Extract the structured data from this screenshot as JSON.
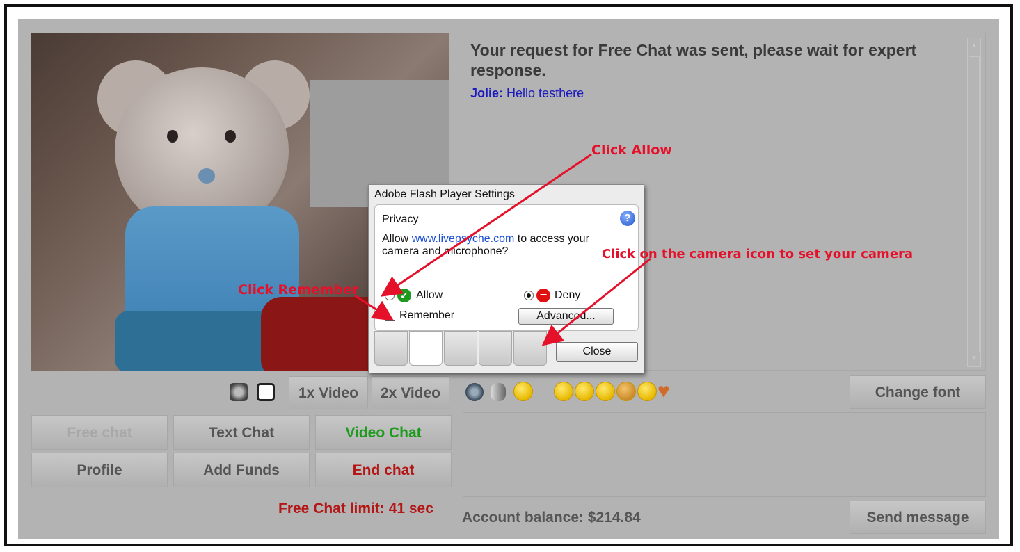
{
  "chat": {
    "system_message": "Your request for Free Chat was sent, please wait for expert response.",
    "sender": "Jolie:",
    "message": "Hello testhere"
  },
  "video_controls": {
    "btn_1x": "1x Video",
    "btn_2x": "2x Video"
  },
  "toolbar": {
    "change_font": "Change font",
    "send_message": "Send message"
  },
  "chat_buttons": {
    "free_chat": "Free chat",
    "text_chat": "Text Chat",
    "video_chat": "Video Chat",
    "profile": "Profile",
    "add_funds": "Add Funds",
    "end_chat": "End chat"
  },
  "status": {
    "free_chat_limit": "Free Chat limit: 41 sec",
    "account_balance": "Account balance: $214.84"
  },
  "flash_dialog": {
    "title": "Adobe Flash Player Settings",
    "section": "Privacy",
    "help": "?",
    "prompt_prefix": "Allow ",
    "prompt_domain": "www.livepsyche.com",
    "prompt_suffix": " to access your",
    "prompt_line2": "camera and microphone?",
    "allow_label": "Allow",
    "deny_label": "Deny",
    "remember_label": "Remember",
    "advanced_button": "Advanced...",
    "close_button": "Close",
    "selected_option": "Deny"
  },
  "annotations": {
    "click_allow": "Click Allow",
    "click_remember": "Click Remember",
    "click_camera": "Click on the camera icon to set your camera"
  },
  "colors": {
    "annotation_red": "#e5102a",
    "end_chat_red": "#b41616",
    "video_chat_green": "#1e9a1e",
    "chat_blue": "#1a1abe"
  },
  "icons": [
    "settings-icon",
    "fullscreen-icon",
    "webcam-icon",
    "microphone-icon",
    "smiley-icons",
    "heart-icon",
    "help-icon",
    "tab-display-icon",
    "tab-privacy-icon",
    "tab-storage-icon",
    "tab-microphone-icon",
    "tab-camera-icon"
  ]
}
